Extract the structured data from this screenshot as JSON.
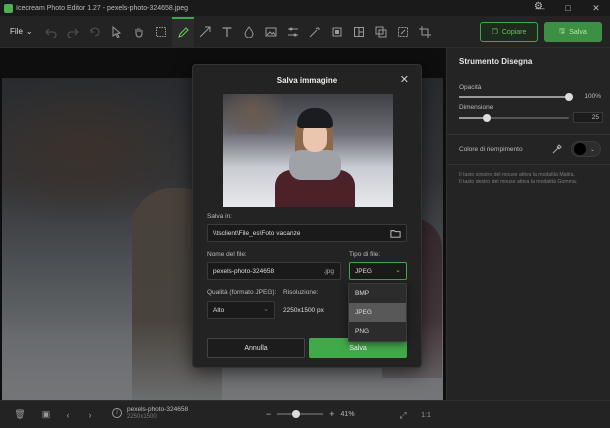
{
  "window": {
    "title": "Icecream Photo Editor 1.27 - pexels-photo-324658.jpeg",
    "minimize": "—",
    "maximize": "□",
    "close": "✕"
  },
  "toolbar": {
    "file_label": "File",
    "copy_label": "Copiare",
    "save_label": "Salva",
    "tools": [
      "undo-icon",
      "redo-icon",
      "rotate-icon",
      "cursor-icon",
      "hand-icon",
      "select-icon",
      "brush-icon",
      "arrow-icon",
      "text-icon",
      "drop-icon",
      "image-icon",
      "adjust-icon",
      "magic-icon",
      "crop-frame-icon",
      "layout-icon",
      "layers-icon",
      "export-icon",
      "crop-icon"
    ],
    "active_tool": "brush-icon"
  },
  "panel": {
    "title": "Strumento Disegna",
    "opacity_label": "Opacità",
    "opacity_value": "100%",
    "opacity_level": 1.0,
    "size_label": "Dimensione",
    "size_value": "25",
    "size_level": 0.25,
    "fill_color_label": "Colore di riempimento",
    "fill_color": "#000000",
    "hint_line1": "Il tasto sinistro del mouse attiva la modalità Matita.",
    "hint_line2": "Il tasto destro del mouse attiva la modalità Gomma."
  },
  "bottombar": {
    "filename": "pexels-photo-324658",
    "dimensions": "2250x1500",
    "zoom": "41%",
    "zoom_level": 0.41,
    "ratio_label": "1:1",
    "minus": "−",
    "plus": "+"
  },
  "dialog": {
    "title": "Salva immagine",
    "close": "✕",
    "save_in_label": "Salva in:",
    "save_in_value": "\\\\tsclient\\File_es\\Foto vacanze",
    "filename_label": "Nome del file:",
    "filename_value": "pexels-photo-324658",
    "extension": ".jpg",
    "filetype_label": "Tipo di file:",
    "filetype_value": "JPEG",
    "quality_label": "Qualità (formato JPEG):",
    "quality_value": "Alto",
    "resolution_label": "Risoluzione:",
    "resolution_value": "2250x1500 px",
    "cancel_label": "Annulla",
    "save_label": "Salva",
    "filetype_options": [
      "BMP",
      "JPEG",
      "PNG"
    ],
    "filetype_selected": "JPEG"
  },
  "colors": {
    "accent": "#42a94b",
    "background": "#1f1f1f",
    "panel": "#242424"
  }
}
